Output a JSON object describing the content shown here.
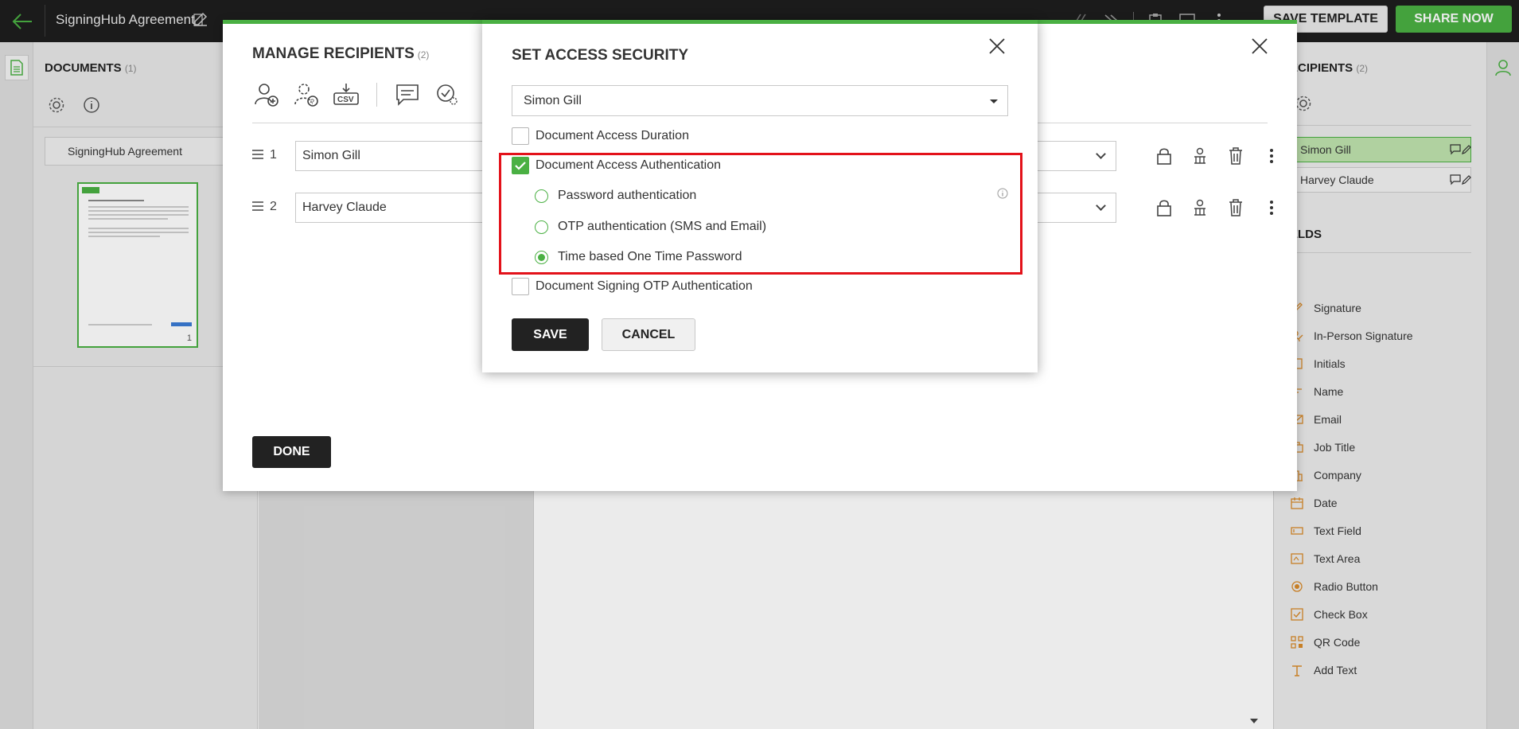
{
  "topbar": {
    "title": "SigningHub Agreement",
    "save_template_label": "SAVE TEMPLATE",
    "share_now_label": "SHARE NOW"
  },
  "documents_panel": {
    "heading": "DOCUMENTS",
    "count": "(1)",
    "document_select": "SigningHub Agreement",
    "thumbnail_page": "1"
  },
  "recipients_panel": {
    "heading": "ECIPIENTS",
    "count": "(2)",
    "recipients": [
      "Simon Gill",
      "Harvey Claude"
    ],
    "fields_heading": "ELDS",
    "fields": [
      {
        "label": "Signature",
        "icon": "signature-icon"
      },
      {
        "label": "In-Person Signature",
        "icon": "in-person-signature-icon"
      },
      {
        "label": "Initials",
        "icon": "initials-icon"
      },
      {
        "label": "Name",
        "icon": "name-icon"
      },
      {
        "label": "Email",
        "icon": "email-icon"
      },
      {
        "label": "Job Title",
        "icon": "job-title-icon"
      },
      {
        "label": "Company",
        "icon": "company-icon"
      },
      {
        "label": "Date",
        "icon": "date-icon"
      },
      {
        "label": "Text Field",
        "icon": "text-field-icon"
      },
      {
        "label": "Text Area",
        "icon": "text-area-icon"
      },
      {
        "label": "Radio Button",
        "icon": "radio-button-icon"
      },
      {
        "label": "Check Box",
        "icon": "check-box-icon"
      },
      {
        "label": "QR Code",
        "icon": "qr-code-icon"
      },
      {
        "label": "Add Text",
        "icon": "add-text-icon"
      }
    ]
  },
  "manage_recipients": {
    "title": "MANAGE RECIPIENTS",
    "count": "(2)",
    "rows": [
      {
        "number": "1",
        "name": "Simon Gill"
      },
      {
        "number": "2",
        "name": "Harvey Claude"
      }
    ],
    "done_label": "DONE"
  },
  "access_security": {
    "title": "SET ACCESS SECURITY",
    "selected_recipient": "Simon Gill",
    "duration_label": "Document Access Duration",
    "duration_checked": false,
    "authentication_label": "Document Access Authentication",
    "authentication_checked": true,
    "auth_options": [
      {
        "label": "Password authentication",
        "selected": false
      },
      {
        "label": "OTP authentication (SMS and Email)",
        "selected": false
      },
      {
        "label": "Time based One Time Password",
        "selected": true
      }
    ],
    "signing_otp_label": "Document Signing OTP Authentication",
    "signing_otp_checked": false,
    "save_label": "SAVE",
    "cancel_label": "CANCEL"
  },
  "colors": {
    "accent": "#4ab043",
    "dark": "#1e1e1e",
    "highlight": "#e3121a",
    "field_icon": "#d88a2a"
  }
}
